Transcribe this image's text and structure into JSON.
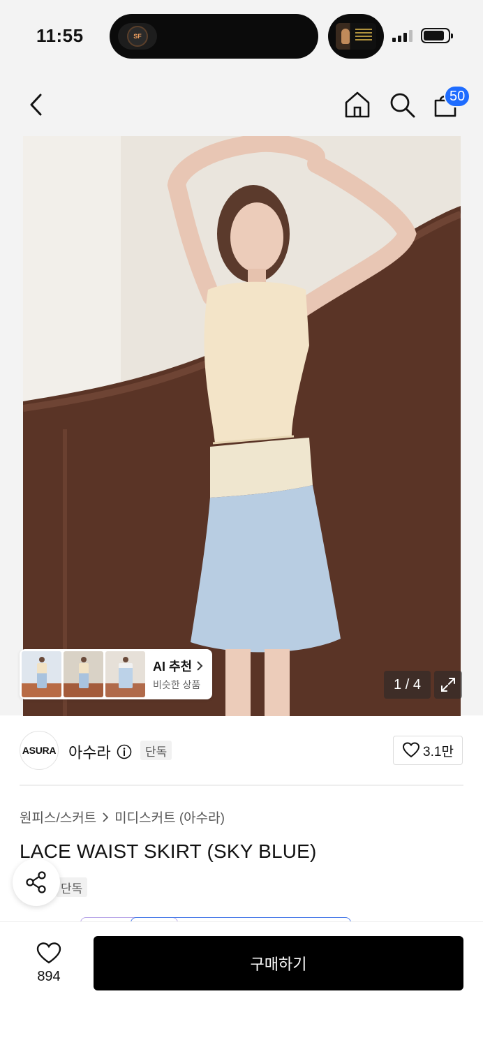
{
  "status_bar": {
    "time": "11:55",
    "island_app_icon": "baseball-team-logo-icon",
    "island_media_icon": "album-art-icon",
    "signal_bars": 3,
    "battery_level": 0.85
  },
  "header": {
    "back_icon": "chevron-left-icon",
    "home_icon": "home-icon",
    "search_icon": "search-icon",
    "cart_icon": "shopping-bag-icon",
    "cart_count": "50"
  },
  "gallery": {
    "ai_recommend_title": "AI 추천",
    "ai_recommend_sub": "비슷한 상품",
    "page_indicator": "1 / 4",
    "expand_icon": "expand-icon"
  },
  "brand": {
    "logo_text": "ASURA",
    "name": "아수라",
    "tag": "단독",
    "like_count": "3.1만"
  },
  "product": {
    "breadcrumb": [
      "원피스/스커트",
      "미디스커트 (아수라)"
    ],
    "title": "LACE WAIST SKIRT (SKY BLUE)",
    "tag": "단독"
  },
  "bottom_bar": {
    "wish_count": "894",
    "buy_label": "구매하기"
  },
  "colors": {
    "accent_badge": "#1e6cff",
    "buy_button": "#000000",
    "background_top": "#f3f3f3"
  }
}
